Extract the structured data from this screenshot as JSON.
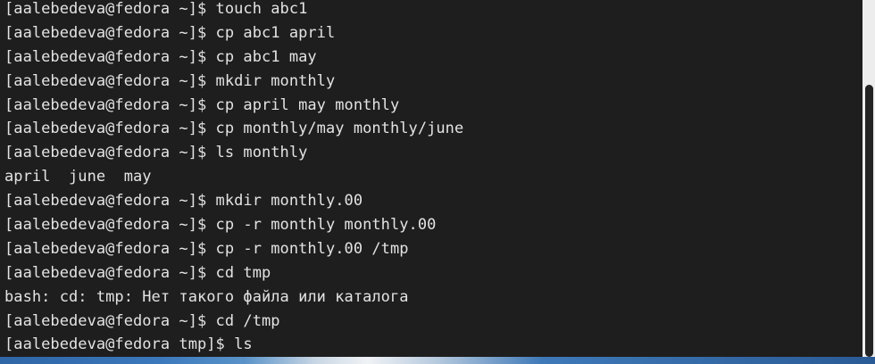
{
  "terminal": {
    "lines": [
      "[aalebedeva@fedora ~]$ touch abc1",
      "[aalebedeva@fedora ~]$ cp abc1 april",
      "[aalebedeva@fedora ~]$ cp abc1 may",
      "[aalebedeva@fedora ~]$ mkdir monthly",
      "[aalebedeva@fedora ~]$ cp april may monthly",
      "[aalebedeva@fedora ~]$ cp monthly/may monthly/june",
      "[aalebedeva@fedora ~]$ ls monthly",
      "april  june  may",
      "[aalebedeva@fedora ~]$ mkdir monthly.00",
      "[aalebedeva@fedora ~]$ cp -r monthly monthly.00",
      "[aalebedeva@fedora ~]$ cp -r monthly.00 /tmp",
      "[aalebedeva@fedora ~]$ cd tmp",
      "bash: cd: tmp: Нет такого файла или каталога",
      "[aalebedeva@fedora ~]$ cd /tmp",
      "[aalebedeva@fedora tmp]$ ls"
    ]
  },
  "colors": {
    "background": "#1e1e1e",
    "text": "#e3e3e3",
    "scrollbar_track": "#ededed",
    "scrollbar_thumb": "#232323"
  }
}
